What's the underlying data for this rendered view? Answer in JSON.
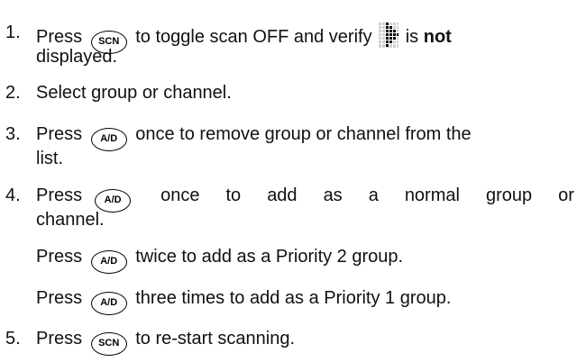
{
  "keys": {
    "scn": "SCN",
    "ad": "A/D"
  },
  "icons": {
    "scan_indicator": "scan-indicator-icon"
  },
  "steps": [
    {
      "num": "1.",
      "a": "Press",
      "b": "to toggle scan OFF and verify",
      "c": "is",
      "d": "not",
      "e": "displayed."
    },
    {
      "num": "2.",
      "a": "Select group or channel."
    },
    {
      "num": "3.",
      "a": "Press",
      "b": "once to remove group or channel from the",
      "c": "list."
    },
    {
      "num": "4.",
      "words": [
        "once",
        "to",
        "add",
        "as",
        "a",
        "normal",
        "group",
        "or"
      ],
      "a": "Press",
      "c": "channel."
    },
    {
      "a": "Press",
      "b": "twice to add as a Priority 2 group."
    },
    {
      "a": "Press",
      "b": "three times to add as a Priority 1 group."
    },
    {
      "num": "5.",
      "a": "Press",
      "b": "to re-start scanning."
    }
  ]
}
